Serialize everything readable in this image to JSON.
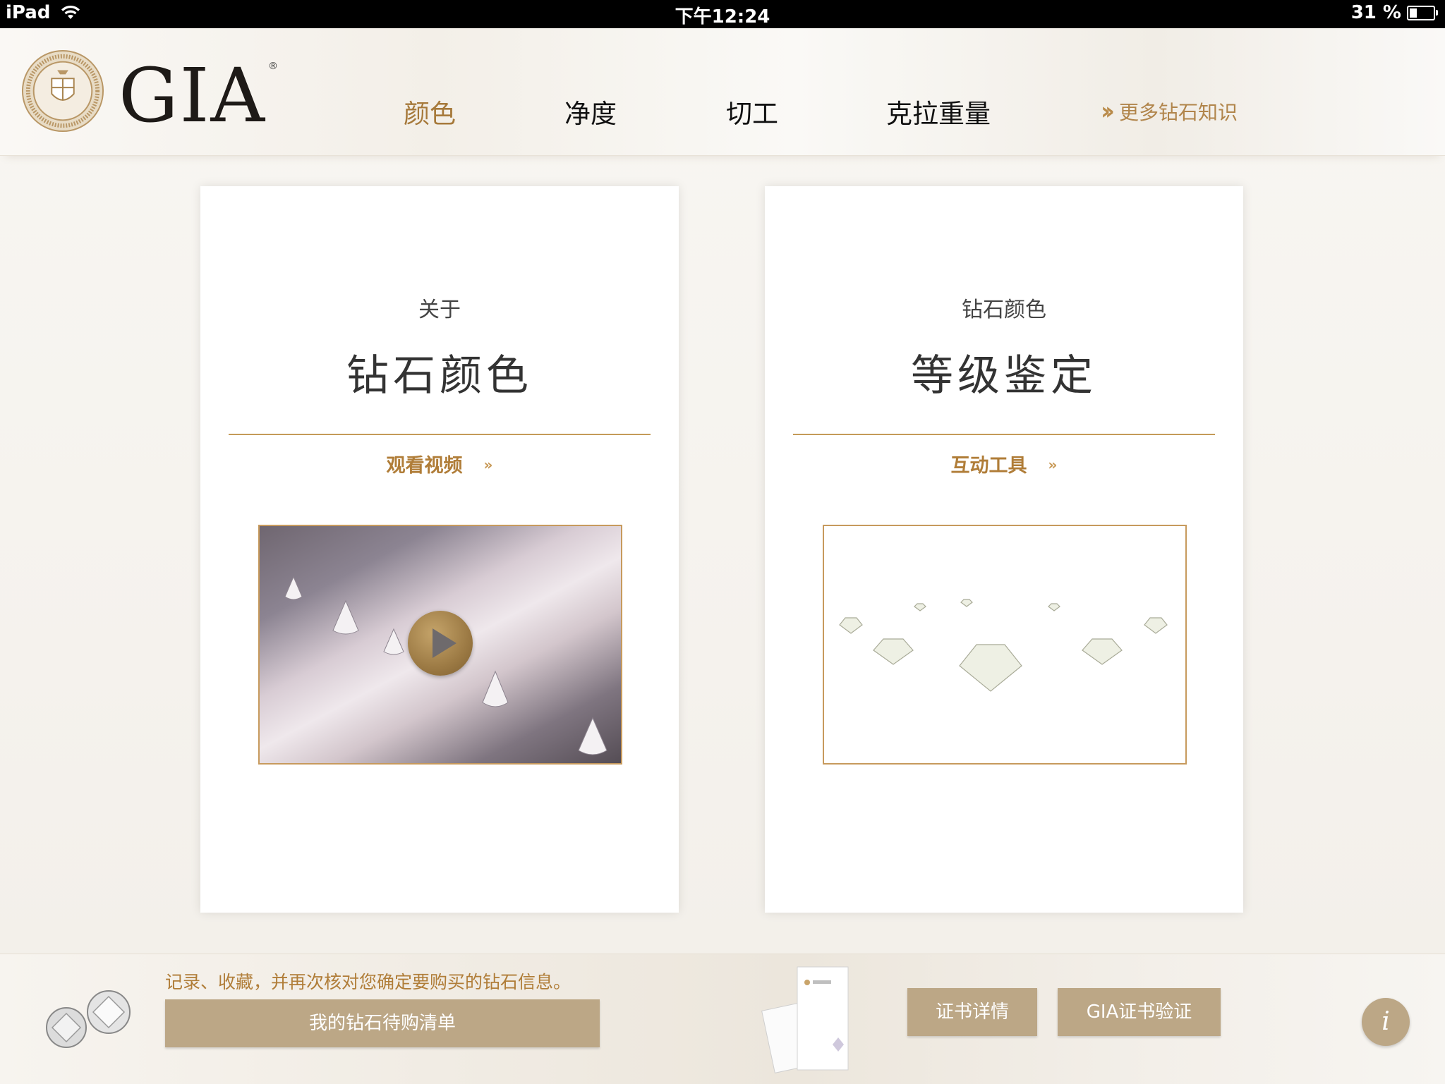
{
  "status_bar": {
    "device": "iPad",
    "time": "下午12:24",
    "battery": "31 %",
    "battery_level": 0.31
  },
  "header": {
    "brand": "GIA",
    "nav": [
      {
        "label": "颜色",
        "active": true
      },
      {
        "label": "净度",
        "active": false
      },
      {
        "label": "切工",
        "active": false
      },
      {
        "label": "克拉重量",
        "active": false
      }
    ],
    "more_link": "更多钻石知识"
  },
  "cards": [
    {
      "supertitle": "关于",
      "title": "钻石颜色",
      "link": "观看视频",
      "link_arrow": "»",
      "media": "video-thumbnail"
    },
    {
      "supertitle": "钻石颜色",
      "title": "等级鉴定",
      "link": "互动工具",
      "link_arrow": "»",
      "media": "diamond-lineup-image"
    }
  ],
  "footer": {
    "note": "记录、收藏，并再次核对您确定要购买的钻石信息。",
    "wishlist_button": "我的钻石待购清单",
    "cert_details_button": "证书详情",
    "cert_verify_button": "GIA证书验证",
    "info_button": "i"
  },
  "colors": {
    "accent_gold": "#a6793a",
    "button_tan": "#bca786"
  }
}
